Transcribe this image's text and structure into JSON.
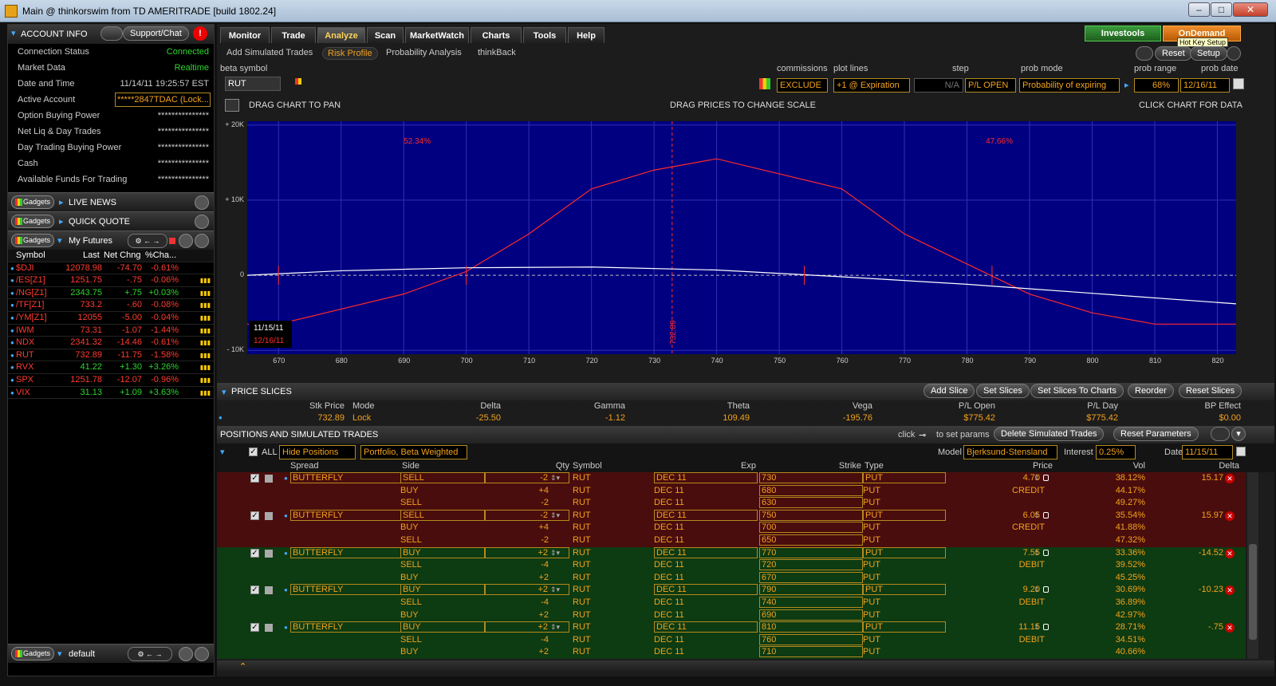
{
  "window": {
    "title": "Main @ thinkorswim from TD AMERITRADE [build 1802.24]"
  },
  "account": {
    "header": "ACCOUNT INFO",
    "support": "Support/Chat",
    "rows": [
      {
        "label": "Connection Status",
        "value": "Connected"
      },
      {
        "label": "Market Data",
        "value": "Realtime"
      },
      {
        "label": "Date and Time",
        "value": "11/14/11 19:25:57 EST"
      },
      {
        "label": "Active Account",
        "value": "*****2847TDAC (Lock..."
      },
      {
        "label": "Option Buying Power",
        "value": "***************"
      },
      {
        "label": "Net Liq & Day Trades",
        "value": "***************"
      },
      {
        "label": "Day Trading Buying Power",
        "value": "***************"
      },
      {
        "label": "Cash",
        "value": "***************"
      },
      {
        "label": "Available Funds For Trading",
        "value": "***************"
      }
    ]
  },
  "gadgets": {
    "badge": "Gadgets",
    "live_news": "LIVE NEWS",
    "quick_quote": "QUICK QUOTE",
    "my_futures": "My Futures",
    "default": "default"
  },
  "futures": {
    "headers": [
      "Symbol",
      "Last",
      "Net Chng",
      "%Cha..."
    ],
    "rows": [
      {
        "symbol": "$DJI",
        "last": "12078.98",
        "chg": "-74.70",
        "pct": "-0.61%"
      },
      {
        "symbol": "/ES[Z1]",
        "last": "1251.75",
        "chg": "-.75",
        "pct": "-0.06%"
      },
      {
        "symbol": "/NG[Z1]",
        "last": "2343.75",
        "chg": "+.75",
        "pct": "+0.03%"
      },
      {
        "symbol": "/TF[Z1]",
        "last": "733.2",
        "chg": "-.60",
        "pct": "-0.08%"
      },
      {
        "symbol": "/YM[Z1]",
        "last": "12055",
        "chg": "-5.00",
        "pct": "-0.04%"
      },
      {
        "symbol": "IWM",
        "last": "73.31",
        "chg": "-1.07",
        "pct": "-1.44%"
      },
      {
        "symbol": "NDX",
        "last": "2341.32",
        "chg": "-14.46",
        "pct": "-0.61%"
      },
      {
        "symbol": "RUT",
        "last": "732.89",
        "chg": "-11.75",
        "pct": "-1.58%"
      },
      {
        "symbol": "RVX",
        "last": "41.22",
        "chg": "+1.30",
        "pct": "+3.26%"
      },
      {
        "symbol": "SPX",
        "last": "1251.78",
        "chg": "-12.07",
        "pct": "-0.96%"
      },
      {
        "symbol": "VIX",
        "last": "31.13",
        "chg": "+1.09",
        "pct": "+3.63%"
      }
    ]
  },
  "tabs": [
    "Monitor",
    "Trade",
    "Analyze",
    "Scan",
    "MarketWatch",
    "Charts",
    "Tools",
    "Help"
  ],
  "subtabs": [
    "Add Simulated Trades",
    "Risk Profile",
    "Probability Analysis",
    "thinkBack"
  ],
  "top_right": {
    "investools": "Investools",
    "ondemand": "OnDemand",
    "hotkey": "Hot Key Setup",
    "reset": "Reset",
    "setup": "Setup"
  },
  "params": {
    "beta_symbol_label": "beta symbol",
    "beta_symbol": "RUT",
    "commissions_label": "commissions",
    "commissions": "EXCLUDE",
    "plot_lines_label": "plot lines",
    "plot_lines": "+1 @ Expiration",
    "step_label": "step",
    "step": "N/A",
    "plopen": "P/L OPEN",
    "prob_mode_label": "prob mode",
    "prob_mode": "Probability of expiring",
    "prob_range_label": "prob range",
    "prob_range": "68%",
    "prob_date_label": "prob date",
    "prob_date": "12/16/11"
  },
  "chart_hints": {
    "pan": "DRAG CHART TO PAN",
    "scale": "DRAG PRICES TO CHANGE SCALE",
    "data": "CLICK CHART FOR DATA"
  },
  "chart_data": {
    "type": "line",
    "x_ticks": [
      "670",
      "680",
      "690",
      "700",
      "710",
      "720",
      "730",
      "740",
      "750",
      "760",
      "770",
      "780",
      "790",
      "800",
      "810",
      "820"
    ],
    "y_ticks": [
      "+ 20K",
      "+ 10K",
      "0",
      "- 10K"
    ],
    "xlim": [
      665,
      823
    ],
    "ylim": [
      -10500,
      20500
    ],
    "left_pct": "52.34%",
    "right_pct": "47.66%",
    "price_marker": "732.89",
    "price_x": 732.89,
    "date_today": "11/15/11",
    "date_exp": "12/16/11",
    "series": [
      {
        "color": "#ff2a2a",
        "x": [
          665,
          670,
          690,
          700,
          710,
          720,
          730,
          740,
          750,
          760,
          770,
          780,
          790,
          800,
          810,
          823
        ],
        "y": [
          -6500,
          -6500,
          -2500,
          500,
          5500,
          11500,
          14000,
          15500,
          13500,
          11500,
          5500,
          1500,
          -2500,
          -5000,
          -6500,
          -6500
        ]
      },
      {
        "color": "#ffffff",
        "x": [
          665,
          680,
          700,
          720,
          740,
          760,
          780,
          800,
          823
        ],
        "y": [
          0,
          600,
          1000,
          1100,
          700,
          -200,
          -1200,
          -2400,
          -3800
        ]
      }
    ]
  },
  "slices": {
    "title": "PRICE SLICES",
    "buttons": [
      "Add Slice",
      "Set Slices",
      "Set Slices To Charts",
      "Reorder",
      "Reset Slices"
    ],
    "headers": [
      "Stk Price",
      "Mode",
      "Delta",
      "Gamma",
      "Theta",
      "Vega",
      "P/L Open",
      "P/L Day",
      "BP Effect"
    ],
    "values": [
      "732.89",
      "Lock",
      "-25.50",
      "-1.12",
      "109.49",
      "-195.76",
      "$775.42",
      "$775.42",
      "$0.00"
    ]
  },
  "positions": {
    "title": "POSITIONS AND SIMULATED TRADES",
    "click_hint": "click",
    "set_params": "to set params",
    "delete_btn": "Delete Simulated Trades",
    "reset_btn": "Reset Parameters",
    "all": "ALL",
    "hide": "Hide Positions",
    "portfolio": "Portfolio, Beta Weighted",
    "model_label": "Model",
    "model": "Bjerksund-Stensland",
    "interest_label": "Interest",
    "interest": "0.25%",
    "date_label": "Date",
    "date": "11/15/11",
    "headers": [
      "Spread",
      "Side",
      "Qty",
      "Symbol",
      "Exp",
      "Strike",
      "Type",
      "Price",
      "Vol",
      "Delta"
    ],
    "rows": [
      {
        "spread": "BUTTERFLY",
        "side": "SELL",
        "qty": "-2",
        "sym": "RUT",
        "exp": "DEC 11",
        "strike": "730",
        "type": "PUT",
        "price": "4.70",
        "vol": "38.12%",
        "delta": "15.17",
        "bg": "red"
      },
      {
        "spread": "",
        "side": "BUY",
        "qty": "+4",
        "sym": "RUT",
        "exp": "DEC 11",
        "strike": "680",
        "type": "PUT",
        "price": "CREDIT",
        "vol": "44.17%",
        "delta": "",
        "bg": "red"
      },
      {
        "spread": "",
        "side": "SELL",
        "qty": "-2",
        "sym": "RUT",
        "exp": "DEC 11",
        "strike": "630",
        "type": "PUT",
        "price": "",
        "vol": "49.27%",
        "delta": "",
        "bg": "red"
      },
      {
        "spread": "BUTTERFLY",
        "side": "SELL",
        "qty": "-2",
        "sym": "RUT",
        "exp": "DEC 11",
        "strike": "750",
        "type": "PUT",
        "price": "6.05",
        "vol": "35.54%",
        "delta": "15.97",
        "bg": "red"
      },
      {
        "spread": "",
        "side": "BUY",
        "qty": "+4",
        "sym": "RUT",
        "exp": "DEC 11",
        "strike": "700",
        "type": "PUT",
        "price": "CREDIT",
        "vol": "41.88%",
        "delta": "",
        "bg": "red"
      },
      {
        "spread": "",
        "side": "SELL",
        "qty": "-2",
        "sym": "RUT",
        "exp": "DEC 11",
        "strike": "650",
        "type": "PUT",
        "price": "",
        "vol": "47.32%",
        "delta": "",
        "bg": "red"
      },
      {
        "spread": "BUTTERFLY",
        "side": "BUY",
        "qty": "+2",
        "sym": "RUT",
        "exp": "DEC 11",
        "strike": "770",
        "type": "PUT",
        "price": "7.55",
        "vol": "33.36%",
        "delta": "-14.52",
        "bg": "green"
      },
      {
        "spread": "",
        "side": "SELL",
        "qty": "-4",
        "sym": "RUT",
        "exp": "DEC 11",
        "strike": "720",
        "type": "PUT",
        "price": "DEBIT",
        "vol": "39.52%",
        "delta": "",
        "bg": "green"
      },
      {
        "spread": "",
        "side": "BUY",
        "qty": "+2",
        "sym": "RUT",
        "exp": "DEC 11",
        "strike": "670",
        "type": "PUT",
        "price": "",
        "vol": "45.25%",
        "delta": "",
        "bg": "green"
      },
      {
        "spread": "BUTTERFLY",
        "side": "BUY",
        "qty": "+2",
        "sym": "RUT",
        "exp": "DEC 11",
        "strike": "790",
        "type": "PUT",
        "price": "9.20",
        "vol": "30.69%",
        "delta": "-10.23",
        "bg": "green"
      },
      {
        "spread": "",
        "side": "SELL",
        "qty": "-4",
        "sym": "RUT",
        "exp": "DEC 11",
        "strike": "740",
        "type": "PUT",
        "price": "DEBIT",
        "vol": "36.89%",
        "delta": "",
        "bg": "green"
      },
      {
        "spread": "",
        "side": "BUY",
        "qty": "+2",
        "sym": "RUT",
        "exp": "DEC 11",
        "strike": "690",
        "type": "PUT",
        "price": "",
        "vol": "42.97%",
        "delta": "",
        "bg": "green"
      },
      {
        "spread": "BUTTERFLY",
        "side": "BUY",
        "qty": "+2",
        "sym": "RUT",
        "exp": "DEC 11",
        "strike": "810",
        "type": "PUT",
        "price": "11.15",
        "vol": "28.71%",
        "delta": "-.75",
        "bg": "green"
      },
      {
        "spread": "",
        "side": "SELL",
        "qty": "-4",
        "sym": "RUT",
        "exp": "DEC 11",
        "strike": "760",
        "type": "PUT",
        "price": "DEBIT",
        "vol": "34.51%",
        "delta": "",
        "bg": "green"
      },
      {
        "spread": "",
        "side": "BUY",
        "qty": "+2",
        "sym": "RUT",
        "exp": "DEC 11",
        "strike": "710",
        "type": "PUT",
        "price": "",
        "vol": "40.66%",
        "delta": "",
        "bg": "green"
      }
    ]
  }
}
